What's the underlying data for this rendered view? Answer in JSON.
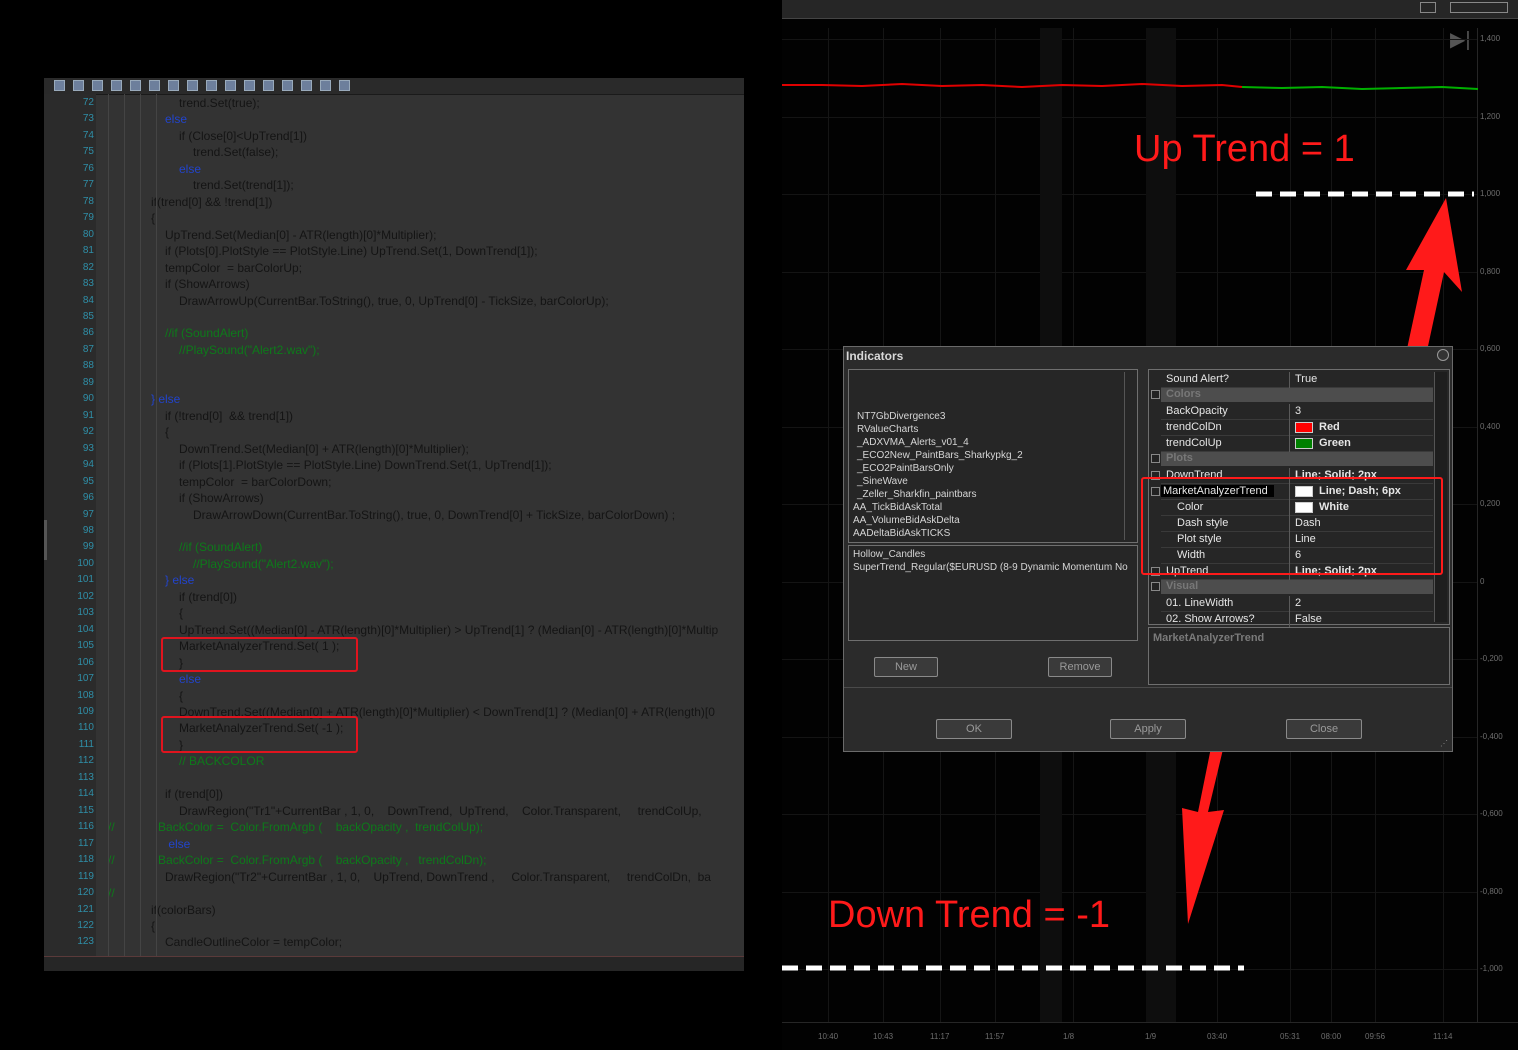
{
  "editor": {
    "toolbar_icons": [
      "save-icon",
      "save-all-icon",
      "compile-icon",
      "print-icon",
      "cut-icon",
      "copy-icon",
      "paste-icon",
      "delete-icon",
      "undo-icon",
      "redo-icon",
      "find-icon",
      "find-replace-icon",
      "indent-icon",
      "outdent-icon",
      "comment-icon",
      "uncomment-icon"
    ],
    "line_numbers": [
      "72",
      "73",
      "74",
      "75",
      "76",
      "77",
      "78",
      "79",
      "80",
      "81",
      "82",
      "83",
      "84",
      "85",
      "86",
      "87",
      "88",
      "89",
      "90",
      "91",
      "92",
      "93",
      "94",
      "95",
      "96",
      "97",
      "98",
      "99",
      "100",
      "101",
      "102",
      "103",
      "104",
      "105",
      "106",
      "107",
      "108",
      "109",
      "110",
      "111",
      "112",
      "113",
      "114",
      "115",
      "116",
      "117",
      "118",
      "119",
      "120",
      "121",
      "122",
      "123"
    ],
    "code_lines": [
      {
        "indent": 2,
        "text": "trend.Set(true);"
      },
      {
        "indent": 1,
        "text": "else"
      },
      {
        "indent": 2,
        "text": "if (Close[0]<UpTrend[1])"
      },
      {
        "indent": 3,
        "text": "trend.Set(false);"
      },
      {
        "indent": 2,
        "text": "else"
      },
      {
        "indent": 3,
        "text": "trend.Set(trend[1]);"
      },
      {
        "indent": 0,
        "text": "if(trend[0] && !trend[1])"
      },
      {
        "indent": 0,
        "text": "{"
      },
      {
        "indent": 1,
        "text": "UpTrend.Set(Median[0] - ATR(length)[0]*Multiplier);"
      },
      {
        "indent": 1,
        "text": "if (Plots[0].PlotStyle == PlotStyle.Line) UpTrend.Set(1, DownTrend[1]);"
      },
      {
        "indent": 1,
        "text": "tempColor  = barColorUp;"
      },
      {
        "indent": 1,
        "text": "if (ShowArrows)"
      },
      {
        "indent": 2,
        "text": "DrawArrowUp(CurrentBar.ToString(), true, 0, UpTrend[0] - TickSize, barColorUp);"
      },
      {
        "indent": 0,
        "text": ""
      },
      {
        "indent": 1,
        "text": "//if (SoundAlert)"
      },
      {
        "indent": 2,
        "text": "//PlaySound(\"Alert2.wav\");"
      },
      {
        "indent": 0,
        "text": ""
      },
      {
        "indent": 0,
        "text": ""
      },
      {
        "indent": 0,
        "text": "} else"
      },
      {
        "indent": 1,
        "text": "if (!trend[0]  && trend[1])"
      },
      {
        "indent": 1,
        "text": "{"
      },
      {
        "indent": 2,
        "text": "DownTrend.Set(Median[0] + ATR(length)[0]*Multiplier);"
      },
      {
        "indent": 2,
        "text": "if (Plots[1].PlotStyle == PlotStyle.Line) DownTrend.Set(1, UpTrend[1]);"
      },
      {
        "indent": 2,
        "text": "tempColor  = barColorDown;"
      },
      {
        "indent": 2,
        "text": "if (ShowArrows)"
      },
      {
        "indent": 3,
        "text": "DrawArrowDown(CurrentBar.ToString(), true, 0, DownTrend[0] + TickSize, barColorDown) ;"
      },
      {
        "indent": 0,
        "text": ""
      },
      {
        "indent": 2,
        "text": "//if (SoundAlert)"
      },
      {
        "indent": 3,
        "text": "//PlaySound(\"Alert2.wav\");"
      },
      {
        "indent": 1,
        "text": "} else"
      },
      {
        "indent": 2,
        "text": "if (trend[0])"
      },
      {
        "indent": 2,
        "text": "{"
      },
      {
        "indent": 2,
        "text": "UpTrend.Set((Median[0] - ATR(length)[0]*Multiplier) > UpTrend[1] ? (Median[0] - ATR(length)[0]*Multip"
      },
      {
        "indent": 2,
        "text": "MarketAnalyzerTrend.Set( 1 );"
      },
      {
        "indent": 2,
        "text": "}"
      },
      {
        "indent": 2,
        "text": "else"
      },
      {
        "indent": 2,
        "text": "{"
      },
      {
        "indent": 2,
        "text": "DownTrend.Set((Median[0] + ATR(length)[0]*Multiplier) < DownTrend[1] ? (Median[0] + ATR(length)[0"
      },
      {
        "indent": 2,
        "text": "MarketAnalyzerTrend.Set( -1 );"
      },
      {
        "indent": 2,
        "text": "}"
      },
      {
        "indent": 2,
        "text": "// BACKCOLOR"
      },
      {
        "indent": 0,
        "text": ""
      },
      {
        "indent": 1,
        "text": "if (trend[0])"
      },
      {
        "indent": 2,
        "text": "DrawRegion(\"Tr1\"+CurrentBar , 1, 0,    DownTrend,  UpTrend,    Color.Transparent,     trendColUp,"
      },
      {
        "indent": -1,
        "text": "//             BackColor =  Color.FromArgb (    backOpacity ,  trendColUp);"
      },
      {
        "indent": 1,
        "text": " else"
      },
      {
        "indent": -1,
        "text": "//             BackColor =  Color.FromArgb (    backOpacity ,   trendColDn);"
      },
      {
        "indent": 1,
        "text": "DrawRegion(\"Tr2\"+CurrentBar , 1, 0,    UpTrend, DownTrend ,     Color.Transparent,     trendColDn,  ba"
      },
      {
        "indent": -1,
        "text": "//"
      },
      {
        "indent": 0,
        "text": "if(colorBars)"
      },
      {
        "indent": 0,
        "text": "{"
      },
      {
        "indent": 1,
        "text": "CandleOutlineColor = tempColor;"
      }
    ]
  },
  "chart": {
    "y_ticks": [
      "1,400",
      "1,200",
      "1,000",
      "0,800",
      "0,600",
      "0,400",
      "0,200",
      "0",
      "-0,200",
      "-0,400",
      "-0,600",
      "-0,800",
      "-1,000"
    ],
    "x_ticks": [
      "10:40",
      "10:43",
      "11:17",
      "11:57",
      "1/8",
      "1/9",
      "03:40",
      "05:31",
      "08:00",
      "09:56",
      "11:14"
    ],
    "annotation_up": "Up Trend = 1",
    "annotation_down": "Down Trend = -1",
    "colors": {
      "annotation": "#ff1a1a",
      "trend_down": "#ff0000",
      "trend_up": "#00c000"
    }
  },
  "dialog": {
    "title": "Indicators",
    "available": [
      "NT7GbDivergence3",
      "RValueCharts",
      "_ADXVMA_Alerts_v01_4",
      "_ECO2New_PaintBars_Sharkypkg_2",
      "_ECO2PaintBarsOnly",
      "_SineWave",
      "_Zeller_Sharkfin_paintbars",
      "AA_TickBidAskTotal",
      "AA_VolumeBidAskDelta",
      "AADeltaBidAskTICKS"
    ],
    "applied": [
      "Hollow_Candles",
      "SuperTrend_Regular($EURUSD (8-9 Dynamic Momentum No"
    ],
    "properties": [
      {
        "kind": "row",
        "key": "Sound Alert?",
        "value": "True"
      },
      {
        "kind": "cat",
        "key": "Colors"
      },
      {
        "kind": "row",
        "key": "BackOpacity",
        "value": "3"
      },
      {
        "kind": "row",
        "key": "trendColDn",
        "value": "Red",
        "swatch": "#ff0000"
      },
      {
        "kind": "row",
        "key": "trendColUp",
        "value": "Green",
        "swatch": "#008000"
      },
      {
        "kind": "cat",
        "key": "Plots"
      },
      {
        "kind": "row",
        "key": "DownTrend",
        "value": "Line; Solid; 2px",
        "expand": "+"
      },
      {
        "kind": "row",
        "key": "MarketAnalyzerTrend",
        "value": "Line; Dash; 6px",
        "swatch": "#ffffff",
        "expand": "−",
        "selected": true
      },
      {
        "kind": "row",
        "key": "Color",
        "value": "White",
        "swatch": "#ffffff",
        "sub": true
      },
      {
        "kind": "row",
        "key": "Dash style",
        "value": "Dash",
        "sub": true
      },
      {
        "kind": "row",
        "key": "Plot style",
        "value": "Line",
        "sub": true
      },
      {
        "kind": "row",
        "key": "Width",
        "value": "6",
        "sub": true
      },
      {
        "kind": "row",
        "key": "UpTrend",
        "value": "Line; Solid; 2px",
        "expand": "+"
      },
      {
        "kind": "cat",
        "key": "Visual"
      },
      {
        "kind": "row",
        "key": "01. LineWidth",
        "value": "2"
      },
      {
        "kind": "row",
        "key": "02. Show Arrows?",
        "value": "False"
      }
    ],
    "description_title": "MarketAnalyzerTrend",
    "buttons": {
      "new": "New",
      "remove": "Remove",
      "ok": "OK",
      "apply": "Apply",
      "close": "Close"
    }
  }
}
